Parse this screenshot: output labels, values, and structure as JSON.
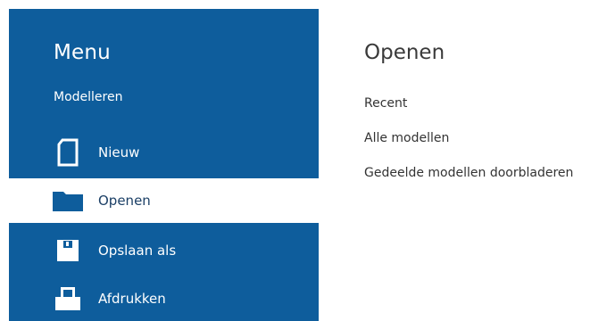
{
  "sidebar": {
    "title": "Menu",
    "section_label": "Modelleren",
    "items": [
      {
        "label": "Nieuw",
        "icon": "new-document-icon",
        "selected": false
      },
      {
        "label": "Openen",
        "icon": "folder-icon",
        "selected": true
      },
      {
        "label": "Opslaan als",
        "icon": "save-icon",
        "selected": false
      },
      {
        "label": "Afdrukken",
        "icon": "printer-icon",
        "selected": false
      }
    ]
  },
  "content": {
    "title": "Openen",
    "links": [
      "Recent",
      "Alle modellen",
      "Gedeelde modellen doorbladeren"
    ]
  },
  "colors": {
    "sidebar_bg": "#0e5d9c",
    "selected_bg": "#ffffff",
    "selected_text": "#1b3f66",
    "content_text": "#333333"
  }
}
